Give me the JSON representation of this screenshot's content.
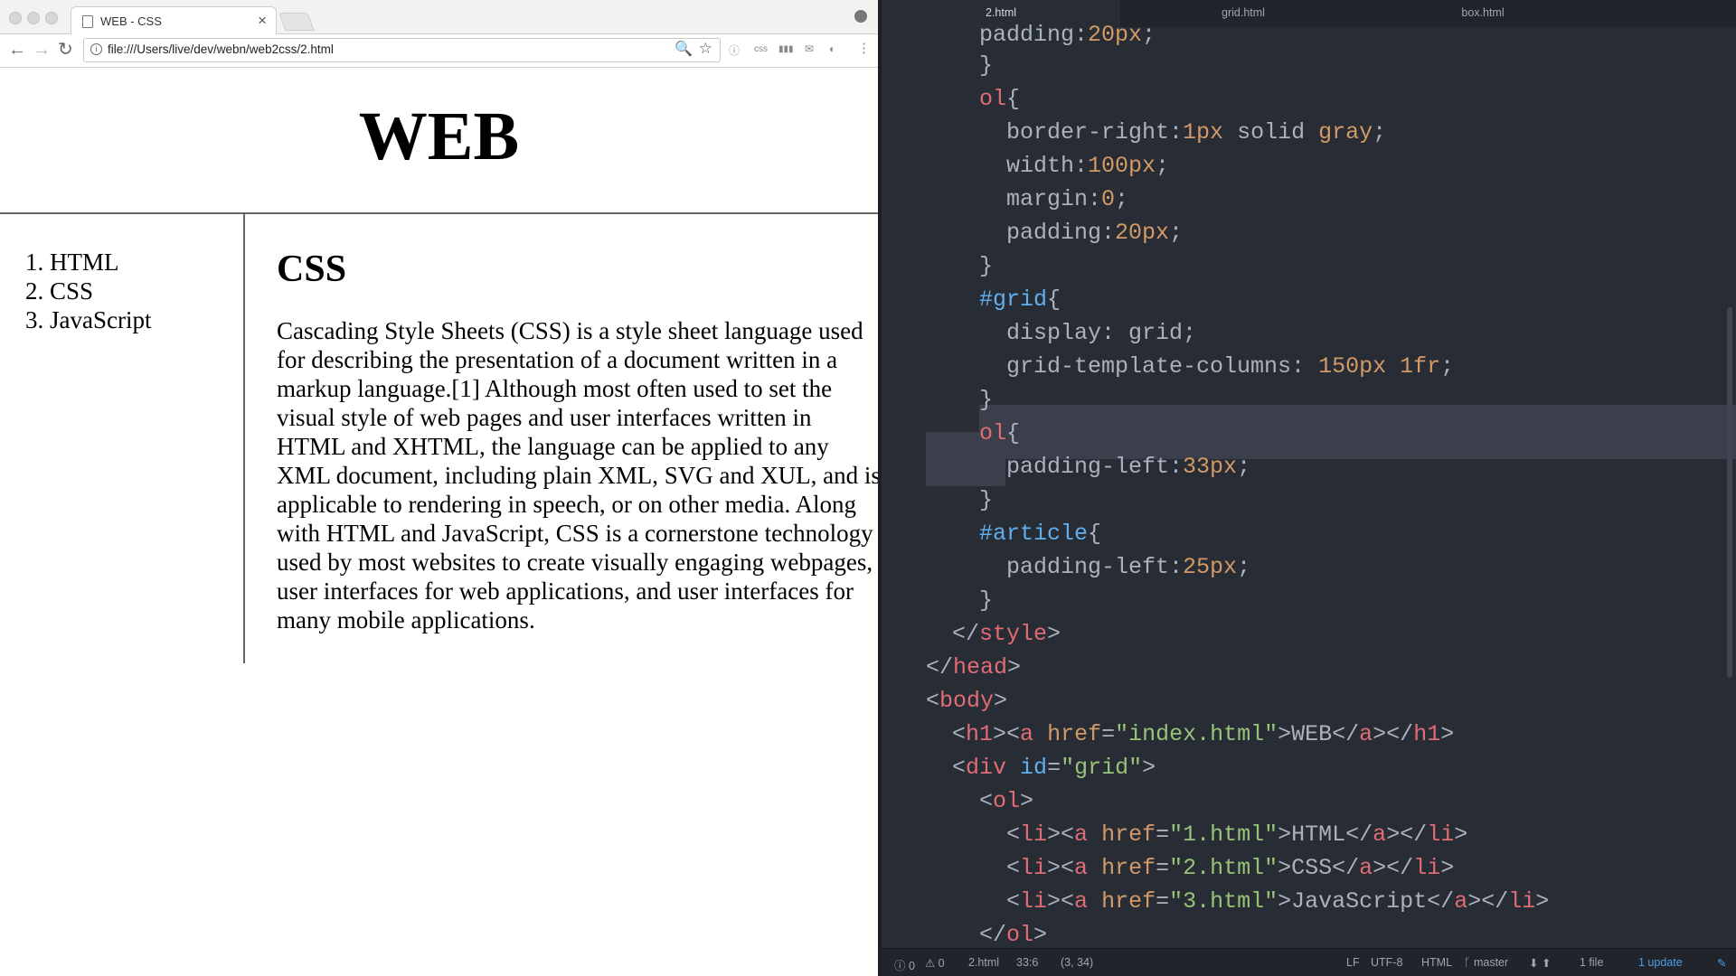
{
  "browser": {
    "tab_title": "WEB - CSS",
    "tab_close": "×",
    "url": "file:///Users/live/dev/webn/web2css/2.html",
    "nav": {
      "back": "←",
      "forward": "→",
      "reload": "↻"
    },
    "omnibox_icons": {
      "info": "i",
      "zoom": "🔍",
      "star": "☆"
    },
    "extensions": [
      "ⓘ",
      "css",
      "▮▮▮",
      "✉",
      "◐",
      "⋮"
    ]
  },
  "page": {
    "title": "WEB",
    "nav_items": [
      "1. HTML",
      "2. CSS",
      "3. JavaScript"
    ],
    "heading": "CSS",
    "body": "Cascading Style Sheets (CSS) is a style sheet language used for describing the presentation of a document written in a markup language.[1] Although most often used to set the visual style of web pages and user interfaces written in HTML and XHTML, the language can be applied to any XML document, including plain XML, SVG and XUL, and is applicable to rendering in speech, or on other media. Along with HTML and JavaScript, CSS is a cornerstone technology used by most websites to create visually engaging webpages, user interfaces for web applications, and user interfaces for many mobile applications."
  },
  "editor": {
    "tabs": [
      "2.html",
      "grid.html",
      "box.html"
    ],
    "status": {
      "errors": "ⓘ 0",
      "warnings": "⚠ 0",
      "file": "2.html",
      "cursor": "33:6",
      "selection": "(3, 34)",
      "line_ending": "LF",
      "encoding": "UTF-8",
      "grammar": "HTML",
      "branch": "ᚴ master",
      "sync": "⬇ ⬆",
      "files": "1 file",
      "update": "1 update"
    }
  }
}
